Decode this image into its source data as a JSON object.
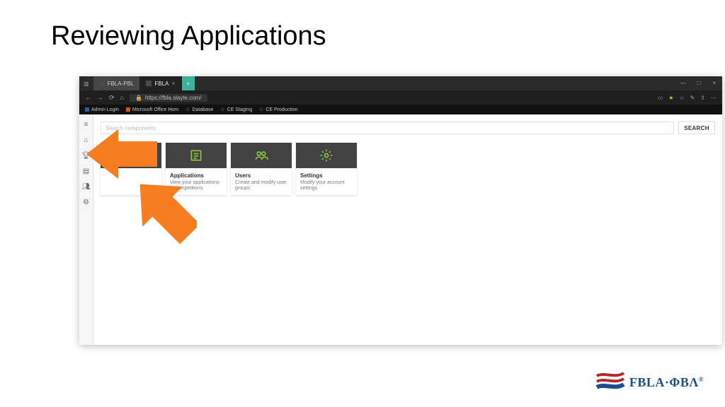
{
  "slide": {
    "title": "Reviewing Applications"
  },
  "browser": {
    "tabs": [
      {
        "label": "FBLA-PBL",
        "active": false
      },
      {
        "label": "FBLA",
        "active": true
      }
    ],
    "address": "https://fbla.slayte.com/",
    "bookmarks": [
      {
        "label": "Admin Login",
        "icon": "blue"
      },
      {
        "label": "Microsoft Office Hom",
        "icon": "orange"
      },
      {
        "label": "Database",
        "icon": "star"
      },
      {
        "label": "CE Staging",
        "icon": "star"
      },
      {
        "label": "CE Production",
        "icon": "star"
      }
    ]
  },
  "app": {
    "search_placeholder": "Search components",
    "search_button": "SEARCH",
    "cards": [
      {
        "title": "",
        "desc": ""
      },
      {
        "title": "Applications",
        "desc": "View your applications in competitions"
      },
      {
        "title": "Users",
        "desc": "Create and modify user groups"
      },
      {
        "title": "Settings",
        "desc": "Modify your account settings"
      }
    ]
  },
  "logo": {
    "text": "FBLA·ΦBΛ",
    "reg": "®"
  }
}
